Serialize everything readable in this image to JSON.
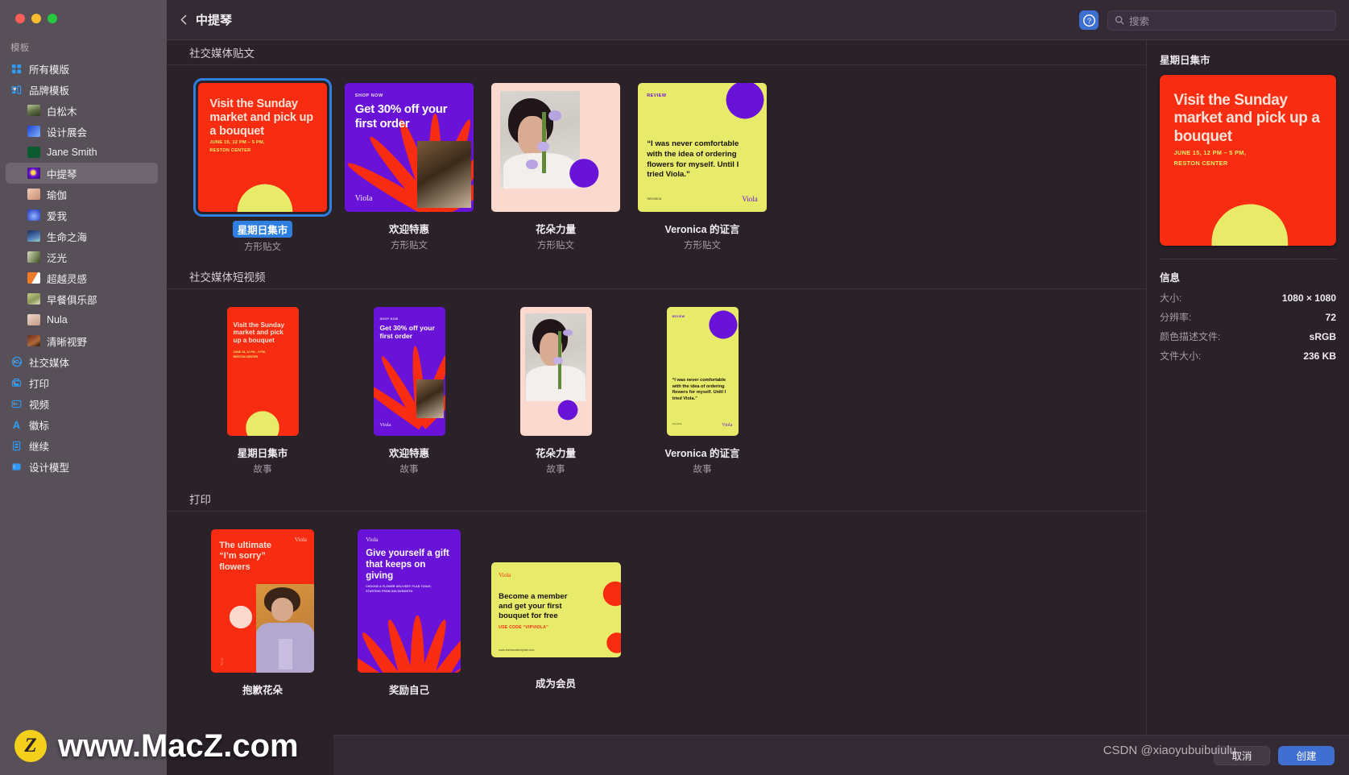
{
  "window": {
    "title": "中提琴",
    "back_icon": "chevron-left-icon",
    "help_icon": "question-mark-circle-icon",
    "accent": "#3f6fd0"
  },
  "search": {
    "placeholder": "搜索",
    "value": "",
    "icon": "search-icon"
  },
  "sidebar": {
    "section_label": "模板",
    "items": [
      {
        "label": "所有模版",
        "icon": "grid-icon",
        "kind": "root",
        "expander": ""
      },
      {
        "label": "品牌模板",
        "icon": "brand-templates-icon",
        "kind": "group",
        "expander": "open"
      },
      {
        "label": "白松木",
        "icon": "thumb-white-pine",
        "kind": "child",
        "swatch": "#8a9a6a"
      },
      {
        "label": "设计展会",
        "icon": "thumb-design-fair",
        "kind": "child",
        "swatch": "#2f5fd0"
      },
      {
        "label": "Jane Smith",
        "icon": "thumb-jane-smith",
        "kind": "child",
        "swatch": "#0e6b3a"
      },
      {
        "label": "中提琴",
        "icon": "thumb-viola",
        "kind": "child",
        "swatch": "#5b1fbf",
        "selected": true
      },
      {
        "label": "瑜伽",
        "icon": "thumb-yoga",
        "kind": "child",
        "swatch": "#d8a08a"
      },
      {
        "label": "爱我",
        "icon": "thumb-love-me",
        "kind": "child",
        "swatch": "#2f3fd0"
      },
      {
        "label": "生命之海",
        "icon": "thumb-sea-of-life",
        "kind": "child",
        "swatch": "#2a3a7a"
      },
      {
        "label": "泛光",
        "icon": "thumb-bloom",
        "kind": "child",
        "swatch": "#7a8a6a"
      },
      {
        "label": "超越灵感",
        "icon": "thumb-beyond-inspiration",
        "kind": "child",
        "swatch": "#e06a20"
      },
      {
        "label": "早餐俱乐部",
        "icon": "thumb-breakfast-club",
        "kind": "child",
        "swatch": "#9aa06a"
      },
      {
        "label": "Nula",
        "icon": "thumb-nula",
        "kind": "child",
        "swatch": "#d6b6a6"
      },
      {
        "label": "清晰视野",
        "icon": "thumb-clear-view",
        "kind": "child",
        "swatch": "#6a2a1a"
      },
      {
        "label": "社交媒体",
        "icon": "at-sign-icon",
        "kind": "group",
        "expander": "closed"
      },
      {
        "label": "打印",
        "icon": "printer-icon",
        "kind": "group",
        "expander": "closed"
      },
      {
        "label": "视频",
        "icon": "video-play-icon",
        "kind": "group",
        "expander": "closed"
      },
      {
        "label": "徽标",
        "icon": "letter-a-icon",
        "kind": "leaf",
        "expander": ""
      },
      {
        "label": "继续",
        "icon": "document-icon",
        "kind": "leaf",
        "expander": ""
      },
      {
        "label": "设计模型",
        "icon": "square-icon",
        "kind": "group",
        "expander": "closed"
      }
    ]
  },
  "groups": [
    {
      "title": "社交媒体贴文",
      "tiles": [
        {
          "label": "星期日集市",
          "sub": "方形贴文",
          "art": "sunday-market",
          "shape": "square",
          "selected": true
        },
        {
          "label": "欢迎特惠",
          "sub": "方形贴文",
          "art": "welcome-offer",
          "shape": "square",
          "selected": false
        },
        {
          "label": "花朵力量",
          "sub": "方形贴文",
          "art": "flower-power",
          "shape": "square",
          "selected": false
        },
        {
          "label": "Veronica 的证言",
          "sub": "方形贴文",
          "art": "veronica-testimonial",
          "shape": "square",
          "selected": false
        }
      ]
    },
    {
      "title": "社交媒体短视频",
      "tiles": [
        {
          "label": "星期日集市",
          "sub": "故事",
          "art": "sunday-market",
          "shape": "story",
          "selected": false
        },
        {
          "label": "欢迎特惠",
          "sub": "故事",
          "art": "welcome-offer",
          "shape": "story",
          "selected": false
        },
        {
          "label": "花朵力量",
          "sub": "故事",
          "art": "flower-power",
          "shape": "story",
          "selected": false
        },
        {
          "label": "Veronica 的证言",
          "sub": "故事",
          "art": "veronica-testimonial",
          "shape": "story",
          "selected": false
        }
      ]
    },
    {
      "title": "打印",
      "tiles": [
        {
          "label": "抱歉花朵",
          "sub": "",
          "art": "sorry-flowers",
          "shape": "print-portrait",
          "selected": false
        },
        {
          "label": "奖励自己",
          "sub": "",
          "art": "treat-yourself",
          "shape": "print-portrait",
          "selected": false
        },
        {
          "label": "成为会员",
          "sub": "",
          "art": "become-member",
          "shape": "print-landscape",
          "selected": false
        }
      ]
    }
  ],
  "artwork_text": {
    "sunday_market": {
      "headline": "Visit the Sunday market and pick up a bouquet",
      "detail_line1": "JUNE 15, 12 PM – 5 PM,",
      "detail_line2": "RESTON CENTER"
    },
    "welcome_offer": {
      "eyebrow": "SHOP NOW",
      "headline": "Get 30% off your first order",
      "brand": "Viola"
    },
    "veronica": {
      "eyebrow": "REVIEW",
      "quote": "“I was never comfortable with the idea of ordering flowers for myself. Until I tried Viola.”",
      "attribution": "Veronica",
      "brand": "Viola"
    },
    "sorry_flowers": {
      "brand": "Viola",
      "headline": "The ultimate “I’m sorry” flowers"
    },
    "treat_yourself": {
      "brand": "Viola",
      "headline": "Give yourself a gift that keeps on giving",
      "detail": "CHOOSE A FLOWER DELIVERY PLAN TODAY, STARTING FROM $49.99/MONTH."
    },
    "become_member": {
      "brand": "Viola",
      "headline": "Become a member and get your first bouquet for free",
      "code": "USE CODE “VIPVIOLA”",
      "url": "www.thebrandtemplate.com"
    }
  },
  "inspector": {
    "title": "星期日集市",
    "info_heading": "信息",
    "rows": [
      {
        "key": "大小:",
        "value": "1080 × 1080"
      },
      {
        "key": "分辨率:",
        "value": "72"
      },
      {
        "key": "颜色描述文件:",
        "value": "sRGB"
      },
      {
        "key": "文件大小:",
        "value": "236 KB"
      }
    ]
  },
  "bottom_bar": {
    "cancel": "取消",
    "create": "创建"
  },
  "watermark": {
    "logo": "Z",
    "text": "www.MacZ.com",
    "credit": "CSDN @xiaoyubuibuiulu"
  },
  "palette": {
    "viola_red": "#f82c10",
    "viola_yellow": "#e8eb6a",
    "viola_purple": "#6a13d8",
    "viola_pink": "#fbd9ce",
    "viola_orange": "#e06a20"
  }
}
